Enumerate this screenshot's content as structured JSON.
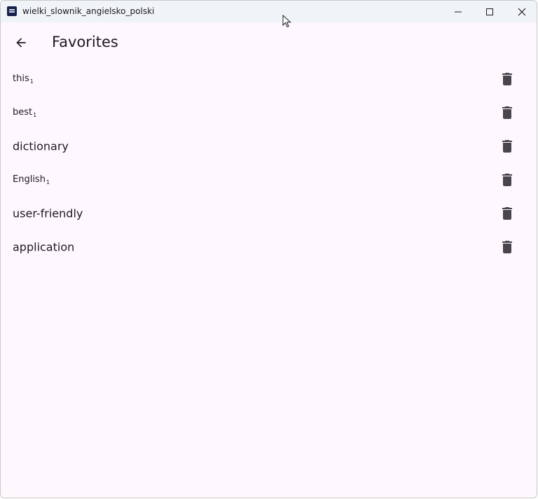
{
  "window": {
    "title": "wielki_slownik_angielsko_polski"
  },
  "appbar": {
    "title": "Favorites",
    "back_icon": "arrow-back-icon"
  },
  "favorites": [
    {
      "word": "this",
      "sup": "1",
      "size": "small"
    },
    {
      "word": "best",
      "sup": "1",
      "size": "small"
    },
    {
      "word": "dictionary",
      "sup": "",
      "size": "large"
    },
    {
      "word": "English",
      "sup": "1",
      "size": "small"
    },
    {
      "word": "user-friendly",
      "sup": "",
      "size": "large"
    },
    {
      "word": "application",
      "sup": "",
      "size": "large"
    }
  ],
  "icons": {
    "delete": "trash-icon"
  },
  "colors": {
    "background": "#fef7fe",
    "titlebar": "#f0f3f8",
    "icon": "#49454f",
    "text": "#1d1b20"
  }
}
